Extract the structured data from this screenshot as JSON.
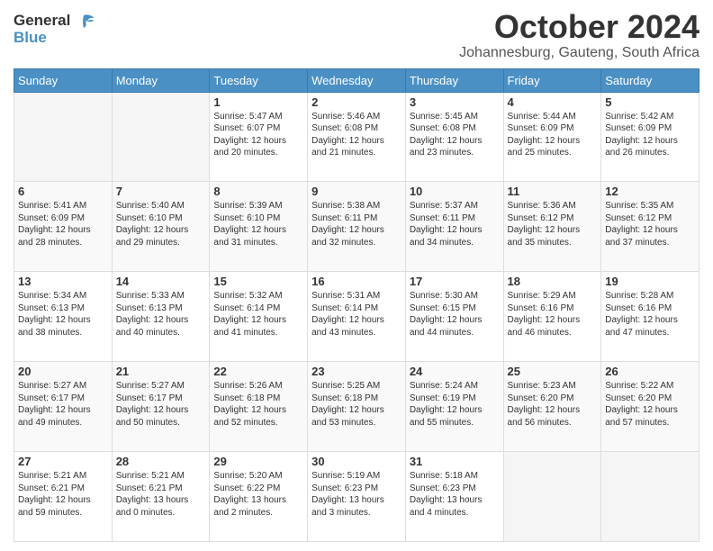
{
  "header": {
    "logo_general": "General",
    "logo_blue": "Blue",
    "month": "October 2024",
    "location": "Johannesburg, Gauteng, South Africa"
  },
  "days_of_week": [
    "Sunday",
    "Monday",
    "Tuesday",
    "Wednesday",
    "Thursday",
    "Friday",
    "Saturday"
  ],
  "weeks": [
    [
      {
        "day": "",
        "info": ""
      },
      {
        "day": "",
        "info": ""
      },
      {
        "day": "1",
        "info": "Sunrise: 5:47 AM\nSunset: 6:07 PM\nDaylight: 12 hours\nand 20 minutes."
      },
      {
        "day": "2",
        "info": "Sunrise: 5:46 AM\nSunset: 6:08 PM\nDaylight: 12 hours\nand 21 minutes."
      },
      {
        "day": "3",
        "info": "Sunrise: 5:45 AM\nSunset: 6:08 PM\nDaylight: 12 hours\nand 23 minutes."
      },
      {
        "day": "4",
        "info": "Sunrise: 5:44 AM\nSunset: 6:09 PM\nDaylight: 12 hours\nand 25 minutes."
      },
      {
        "day": "5",
        "info": "Sunrise: 5:42 AM\nSunset: 6:09 PM\nDaylight: 12 hours\nand 26 minutes."
      }
    ],
    [
      {
        "day": "6",
        "info": "Sunrise: 5:41 AM\nSunset: 6:09 PM\nDaylight: 12 hours\nand 28 minutes."
      },
      {
        "day": "7",
        "info": "Sunrise: 5:40 AM\nSunset: 6:10 PM\nDaylight: 12 hours\nand 29 minutes."
      },
      {
        "day": "8",
        "info": "Sunrise: 5:39 AM\nSunset: 6:10 PM\nDaylight: 12 hours\nand 31 minutes."
      },
      {
        "day": "9",
        "info": "Sunrise: 5:38 AM\nSunset: 6:11 PM\nDaylight: 12 hours\nand 32 minutes."
      },
      {
        "day": "10",
        "info": "Sunrise: 5:37 AM\nSunset: 6:11 PM\nDaylight: 12 hours\nand 34 minutes."
      },
      {
        "day": "11",
        "info": "Sunrise: 5:36 AM\nSunset: 6:12 PM\nDaylight: 12 hours\nand 35 minutes."
      },
      {
        "day": "12",
        "info": "Sunrise: 5:35 AM\nSunset: 6:12 PM\nDaylight: 12 hours\nand 37 minutes."
      }
    ],
    [
      {
        "day": "13",
        "info": "Sunrise: 5:34 AM\nSunset: 6:13 PM\nDaylight: 12 hours\nand 38 minutes."
      },
      {
        "day": "14",
        "info": "Sunrise: 5:33 AM\nSunset: 6:13 PM\nDaylight: 12 hours\nand 40 minutes."
      },
      {
        "day": "15",
        "info": "Sunrise: 5:32 AM\nSunset: 6:14 PM\nDaylight: 12 hours\nand 41 minutes."
      },
      {
        "day": "16",
        "info": "Sunrise: 5:31 AM\nSunset: 6:14 PM\nDaylight: 12 hours\nand 43 minutes."
      },
      {
        "day": "17",
        "info": "Sunrise: 5:30 AM\nSunset: 6:15 PM\nDaylight: 12 hours\nand 44 minutes."
      },
      {
        "day": "18",
        "info": "Sunrise: 5:29 AM\nSunset: 6:16 PM\nDaylight: 12 hours\nand 46 minutes."
      },
      {
        "day": "19",
        "info": "Sunrise: 5:28 AM\nSunset: 6:16 PM\nDaylight: 12 hours\nand 47 minutes."
      }
    ],
    [
      {
        "day": "20",
        "info": "Sunrise: 5:27 AM\nSunset: 6:17 PM\nDaylight: 12 hours\nand 49 minutes."
      },
      {
        "day": "21",
        "info": "Sunrise: 5:27 AM\nSunset: 6:17 PM\nDaylight: 12 hours\nand 50 minutes."
      },
      {
        "day": "22",
        "info": "Sunrise: 5:26 AM\nSunset: 6:18 PM\nDaylight: 12 hours\nand 52 minutes."
      },
      {
        "day": "23",
        "info": "Sunrise: 5:25 AM\nSunset: 6:18 PM\nDaylight: 12 hours\nand 53 minutes."
      },
      {
        "day": "24",
        "info": "Sunrise: 5:24 AM\nSunset: 6:19 PM\nDaylight: 12 hours\nand 55 minutes."
      },
      {
        "day": "25",
        "info": "Sunrise: 5:23 AM\nSunset: 6:20 PM\nDaylight: 12 hours\nand 56 minutes."
      },
      {
        "day": "26",
        "info": "Sunrise: 5:22 AM\nSunset: 6:20 PM\nDaylight: 12 hours\nand 57 minutes."
      }
    ],
    [
      {
        "day": "27",
        "info": "Sunrise: 5:21 AM\nSunset: 6:21 PM\nDaylight: 12 hours\nand 59 minutes."
      },
      {
        "day": "28",
        "info": "Sunrise: 5:21 AM\nSunset: 6:21 PM\nDaylight: 13 hours\nand 0 minutes."
      },
      {
        "day": "29",
        "info": "Sunrise: 5:20 AM\nSunset: 6:22 PM\nDaylight: 13 hours\nand 2 minutes."
      },
      {
        "day": "30",
        "info": "Sunrise: 5:19 AM\nSunset: 6:23 PM\nDaylight: 13 hours\nand 3 minutes."
      },
      {
        "day": "31",
        "info": "Sunrise: 5:18 AM\nSunset: 6:23 PM\nDaylight: 13 hours\nand 4 minutes."
      },
      {
        "day": "",
        "info": ""
      },
      {
        "day": "",
        "info": ""
      }
    ]
  ]
}
